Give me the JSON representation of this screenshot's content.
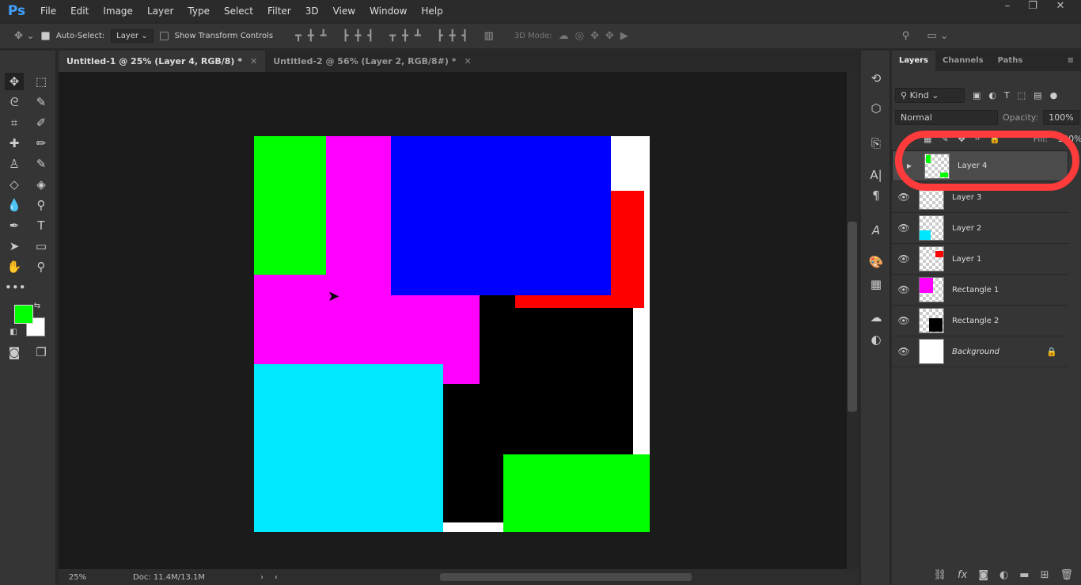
{
  "app": {
    "logo": "Ps",
    "window_controls": [
      "–",
      "❐",
      "✕"
    ]
  },
  "menu": [
    "File",
    "Edit",
    "Image",
    "Layer",
    "Type",
    "Select",
    "Filter",
    "3D",
    "View",
    "Window",
    "Help"
  ],
  "options": {
    "auto_select_label": "Auto-Select:",
    "auto_select_checked": true,
    "auto_select_target": "Layer",
    "show_transform_label": "Show Transform Controls",
    "show_transform_checked": false,
    "mode_3d_label": "3D Mode:"
  },
  "tabs": [
    {
      "label": "Untitled-1 @ 25% (Layer 4, RGB/8) *",
      "active": true
    },
    {
      "label": "Untitled-2 @ 56% (Layer 2, RGB/8#) *",
      "active": false
    }
  ],
  "status": {
    "zoom": "25%",
    "doc": "Doc: 11.4M/13.1M"
  },
  "colors": {
    "foreground": "#00ff00",
    "background": "#ffffff",
    "highlight_ring": "#ff3b3b"
  },
  "canvas_colors": {
    "background": "#ffffff",
    "rectangle2": "#000000",
    "rectangle1": "#ff00ff",
    "layer1": "#ff0000",
    "layer2": "#00e5ff",
    "layer3": "#0000ff",
    "layer4": "#00ff00"
  },
  "panel": {
    "tabs": [
      "Layers",
      "Channels",
      "Paths"
    ],
    "filter": "Kind",
    "blend_mode": "Normal",
    "opacity_label": "Opacity:",
    "opacity": "100%",
    "fill_label": "Fill:",
    "fill": "100%",
    "layers": [
      {
        "name": "Layer 4",
        "visible": true,
        "selected": true
      },
      {
        "name": "Layer 3",
        "visible": true
      },
      {
        "name": "Layer 2",
        "visible": true
      },
      {
        "name": "Layer 1",
        "visible": true
      },
      {
        "name": "Rectangle 1",
        "visible": true
      },
      {
        "name": "Rectangle 2",
        "visible": true
      },
      {
        "name": "Background",
        "visible": true,
        "locked": true
      }
    ]
  }
}
